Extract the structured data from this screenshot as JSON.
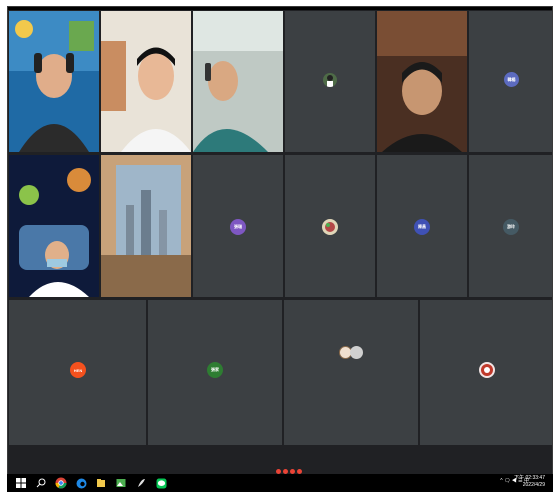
{
  "tiles": [
    {
      "name": "",
      "initials": ""
    },
    {
      "name": "",
      "initials": ""
    },
    {
      "name": "",
      "initials": ""
    },
    {
      "name": "",
      "initials": ""
    },
    {
      "name": "",
      "initials": ""
    },
    {
      "name": "",
      "initials": "韓楊",
      "color": "#5c6bc0"
    },
    {
      "name": "",
      "initials": ""
    },
    {
      "name": "",
      "initials": ""
    },
    {
      "name": "",
      "initials": "張瑞",
      "color": "#7e57c2"
    },
    {
      "name": "",
      "initials": ""
    },
    {
      "name": "",
      "initials": "陳昌",
      "color": "#3f51b5"
    },
    {
      "name": "",
      "initials": "游玲",
      "color": "#455a64"
    },
    {
      "name": "",
      "initials": "HEN",
      "color": "#f4511e"
    },
    {
      "name": "",
      "initials": "張家",
      "color": "#2e7d32"
    },
    {
      "name": "",
      "initials": ""
    },
    {
      "name": "",
      "initials": ""
    }
  ],
  "meeting": {
    "title": "",
    "presenter_caption": ""
  },
  "taskbar": {
    "icons": [
      "windows-icon",
      "search-icon",
      "chrome-icon",
      "edge-icon",
      "files-icon",
      "photos-icon",
      "feather-icon",
      "line-icon"
    ],
    "tray": "^ 🗨 ◀ ☰ 中",
    "time": "下午 02:33:47",
    "date": "2022/4/29"
  },
  "colors": {
    "meet_bg": "#202124",
    "tile_bg": "#3c4043",
    "taskbar": "#000000"
  }
}
